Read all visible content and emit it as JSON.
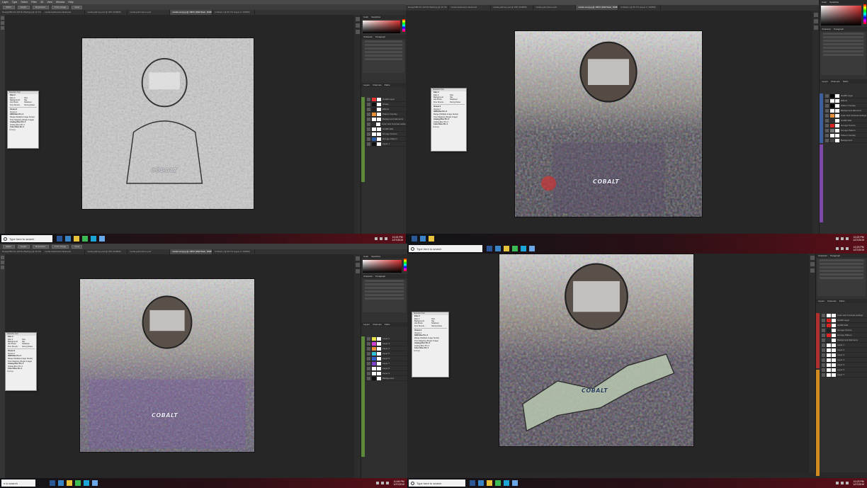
{
  "menu": [
    "Layer",
    "Type",
    "Select",
    "Filter",
    "3D",
    "View",
    "Window",
    "Help"
  ],
  "options": [
    "Width:",
    "Height:",
    "Resolution:",
    "Front Image",
    "Clear"
  ],
  "doc_tabs": [
    "DesignMB-CO-1AT-B-c5a2f.jpg @ 16.7% (RGB/8)",
    "model-lookboard-cobalt.psd",
    "model-grid-top.psd @ 33% (RGB/8)",
    "model-grid-bottom.psd",
    "model-cool.jpg @ 100% (Wall Stain, RGB/8)",
    "Untitled-1 @ 66.7% (Layer 0, RGB/8)"
  ],
  "artwork_text": "COBALT",
  "panels": {
    "color_tabs": [
      "Color",
      "Swatches"
    ],
    "char_tabs": [
      "Character",
      "Paragraph"
    ],
    "layer_tabs": [
      "Layers",
      "Channels",
      "Paths"
    ]
  },
  "layers": [
    "Graffiti Layer",
    "Stroke",
    "Effects",
    "Pattern Overlay",
    "Background Elements",
    "Color and Contrast settings",
    "Graffiti Wall",
    "Grunge Texture",
    "Grunge Pattern",
    "Layer 1",
    "Layer 2",
    "Layer 3",
    "Layer 4",
    "Layer 5",
    "Layer 6",
    "Layer 7",
    "Layer 8",
    "Layer 9",
    "Background"
  ],
  "dialog": {
    "title": "Selection Tool",
    "section1": "Efex 2",
    "opts": [
      [
        "Efex 2",
        "Size"
      ],
      [
        "Background",
        "Sky"
      ],
      [
        "Hot Pixels",
        "Shadows"
      ],
      [
        "Fine Structu...",
        "Strong Noise"
      ]
    ],
    "items": [
      "Viveza 2",
      "Viveza 2",
      "HDR Efex Pro 2",
      "Range (Multiple Image Series)",
      "Tone Mapping (Single Image)",
      "Analog Efex Pro 2",
      "Analog Efex Pro 2",
      "Color Efex Pro 4"
    ],
    "settings": "Settings"
  },
  "taskbar": {
    "search_placeholder": "Type here to search",
    "search_short": "e to search",
    "times": [
      "10:22 PM",
      "10:22 PM",
      "10:49 PM",
      "10:23 PM"
    ],
    "date": "1/27/2019",
    "icon_colors": [
      "#2b5797",
      "#3a85c8",
      "#e8c23a",
      "#3cba54",
      "#1aa5d6",
      "#6aa8e8",
      "#8fb3d9"
    ]
  }
}
